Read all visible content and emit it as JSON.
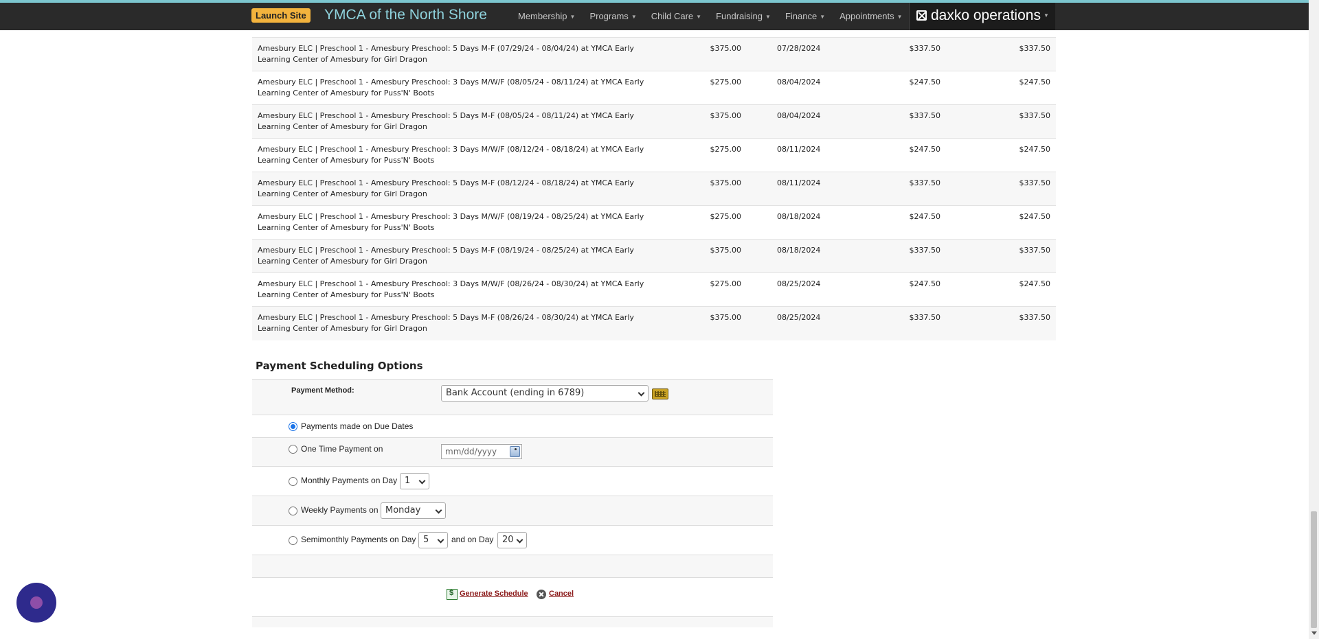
{
  "header": {
    "launch_label": "Launch Site",
    "org_name": "YMCA of the North Shore",
    "nav": [
      "Membership",
      "Programs",
      "Child Care",
      "Fundraising",
      "Finance",
      "Appointments"
    ],
    "brand": "daxko operations"
  },
  "fees": [
    {
      "description": "Amesbury ELC | Preschool 1 - Amesbury Preschool: 5 Days M-F (07/29/24 - 08/04/24) at YMCA Early Learning Center of Amesbury for Girl Dragon",
      "amount": "$375.00",
      "date": "07/28/2024",
      "discounted": "$337.50",
      "total": "$337.50"
    },
    {
      "description": "Amesbury ELC | Preschool 1 - Amesbury Preschool: 3 Days M/W/F (08/05/24 - 08/11/24) at YMCA Early Learning Center of Amesbury for Puss'N' Boots",
      "amount": "$275.00",
      "date": "08/04/2024",
      "discounted": "$247.50",
      "total": "$247.50"
    },
    {
      "description": "Amesbury ELC | Preschool 1 - Amesbury Preschool: 5 Days M-F (08/05/24 - 08/11/24) at YMCA Early Learning Center of Amesbury for Girl Dragon",
      "amount": "$375.00",
      "date": "08/04/2024",
      "discounted": "$337.50",
      "total": "$337.50"
    },
    {
      "description": "Amesbury ELC | Preschool 1 - Amesbury Preschool: 3 Days M/W/F (08/12/24 - 08/18/24) at YMCA Early Learning Center of Amesbury for Puss'N' Boots",
      "amount": "$275.00",
      "date": "08/11/2024",
      "discounted": "$247.50",
      "total": "$247.50"
    },
    {
      "description": "Amesbury ELC | Preschool 1 - Amesbury Preschool: 5 Days M-F (08/12/24 - 08/18/24) at YMCA Early Learning Center of Amesbury for Girl Dragon",
      "amount": "$375.00",
      "date": "08/11/2024",
      "discounted": "$337.50",
      "total": "$337.50"
    },
    {
      "description": "Amesbury ELC | Preschool 1 - Amesbury Preschool: 3 Days M/W/F (08/19/24 - 08/25/24) at YMCA Early Learning Center of Amesbury for Puss'N' Boots",
      "amount": "$275.00",
      "date": "08/18/2024",
      "discounted": "$247.50",
      "total": "$247.50"
    },
    {
      "description": "Amesbury ELC | Preschool 1 - Amesbury Preschool: 5 Days M-F (08/19/24 - 08/25/24) at YMCA Early Learning Center of Amesbury for Girl Dragon",
      "amount": "$375.00",
      "date": "08/18/2024",
      "discounted": "$337.50",
      "total": "$337.50"
    },
    {
      "description": "Amesbury ELC | Preschool 1 - Amesbury Preschool: 3 Days M/W/F (08/26/24 - 08/30/24) at YMCA Early Learning Center of Amesbury for Puss'N' Boots",
      "amount": "$275.00",
      "date": "08/25/2024",
      "discounted": "$247.50",
      "total": "$247.50"
    },
    {
      "description": "Amesbury ELC | Preschool 1 - Amesbury Preschool: 5 Days M-F (08/26/24 - 08/30/24) at YMCA Early Learning Center of Amesbury for Girl Dragon",
      "amount": "$375.00",
      "date": "08/25/2024",
      "discounted": "$337.50",
      "total": "$337.50"
    }
  ],
  "payment": {
    "title": "Payment Scheduling Options",
    "method_label": "Payment Method:",
    "method_value": "Bank Account (ending in 6789)",
    "opt_due": "Payments made on Due Dates",
    "opt_once": "One Time Payment on",
    "once_placeholder": "mm/dd/yyyy",
    "opt_monthly": "Monthly Payments on Day",
    "monthly_day": "1",
    "opt_weekly": "Weekly Payments on",
    "weekly_day": "Monday",
    "opt_semi": "Semimonthly Payments on Day",
    "semi_day1": "5",
    "semi_and": "and on Day",
    "semi_day2": "20",
    "generate_label": "Generate Schedule",
    "cancel_label": "Cancel"
  },
  "colors": {
    "header_bg": "#2a2a2a",
    "launch_btn": "#f3b33d",
    "org_name": "#8fd3dd",
    "link_red": "#8b1a1a",
    "chat_bubble": "#2e2a8c"
  }
}
